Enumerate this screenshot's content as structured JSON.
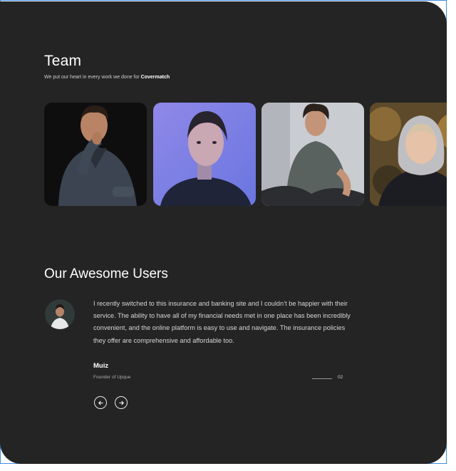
{
  "team": {
    "title": "Team",
    "subtitle_prefix": "We put our heart in every work we done for",
    "subtitle_brand": "Covermatch",
    "members": [
      {
        "photo_icon": "man-in-dark-shirt-photo"
      },
      {
        "photo_icon": "woman-blue-light-photo"
      },
      {
        "photo_icon": "man-sitting-tshirt-photo"
      },
      {
        "photo_icon": "woman-hoodie-photo"
      }
    ]
  },
  "testimonials": {
    "title": "Our Awesome Users",
    "quote": "I recently switched to this insurance and banking site and I couldn’t be happier with their service. The ability to have all of my financial needs met in one place has been incredibly convenient, and the online platform is easy to use and navigate. The insurance policies they offer are comprehensive and affordable too.",
    "author_name": "Muiz",
    "author_role": "Founder of Upque",
    "page_number": "02",
    "prev_icon": "arrow-left-icon",
    "next_icon": "arrow-right-icon"
  }
}
